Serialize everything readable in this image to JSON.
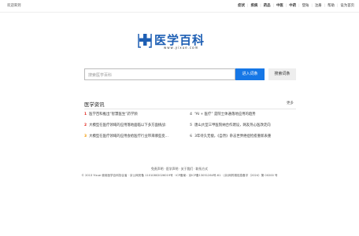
{
  "topbar": {
    "welcome": "欢迎来到",
    "nav": [
      "症状",
      "疾病",
      "药品",
      "中医",
      "中药",
      "登陆",
      "注册",
      "帮助",
      "设为首页"
    ]
  },
  "logo": {
    "title": "医学百科",
    "url": "www.yixue.com"
  },
  "search": {
    "placeholder": "搜索医学百科",
    "enter_label": "进入词条",
    "search_label": "搜索词条"
  },
  "news": {
    "title": "医学资讯",
    "more": "更多",
    "items": [
      {
        "num": "1",
        "text": "医学百科推出“智慧医生”药学频"
      },
      {
        "num": "2",
        "text": "大模型在医疗领域的应用落地面临以下多方面挑战:"
      },
      {
        "num": "3",
        "text": "大模型在医疗领域的应用会给医疗行业带来哪些变..."
      },
      {
        "num": "4",
        "text": "“AI + 医疗” 是院士体通落地应用的趋势"
      },
      {
        "num": "5",
        "text": "唐山大型三甲医院纳合作建设，网友热心医改走向"
      },
      {
        "num": "6",
        "text": "3年待久无偿，《自然》杂志世界癌症检疫重新表重"
      }
    ]
  },
  "footer": {
    "links": [
      "免责声明",
      "医学声明",
      "关于我们",
      "联系方式"
    ],
    "copyright": "© 2013 Yixue 使用医学百科协议者 · 京公网安备 11010802026019号 · ICP备案：京ICP备13051264号-61 · (京)网药械信息备字（2024）第 00200 号"
  },
  "colors": {
    "accent": "#1677e6",
    "logo": "#1e5fb4",
    "rank_top": "#e2231a",
    "rank_mid": "#f39800"
  }
}
